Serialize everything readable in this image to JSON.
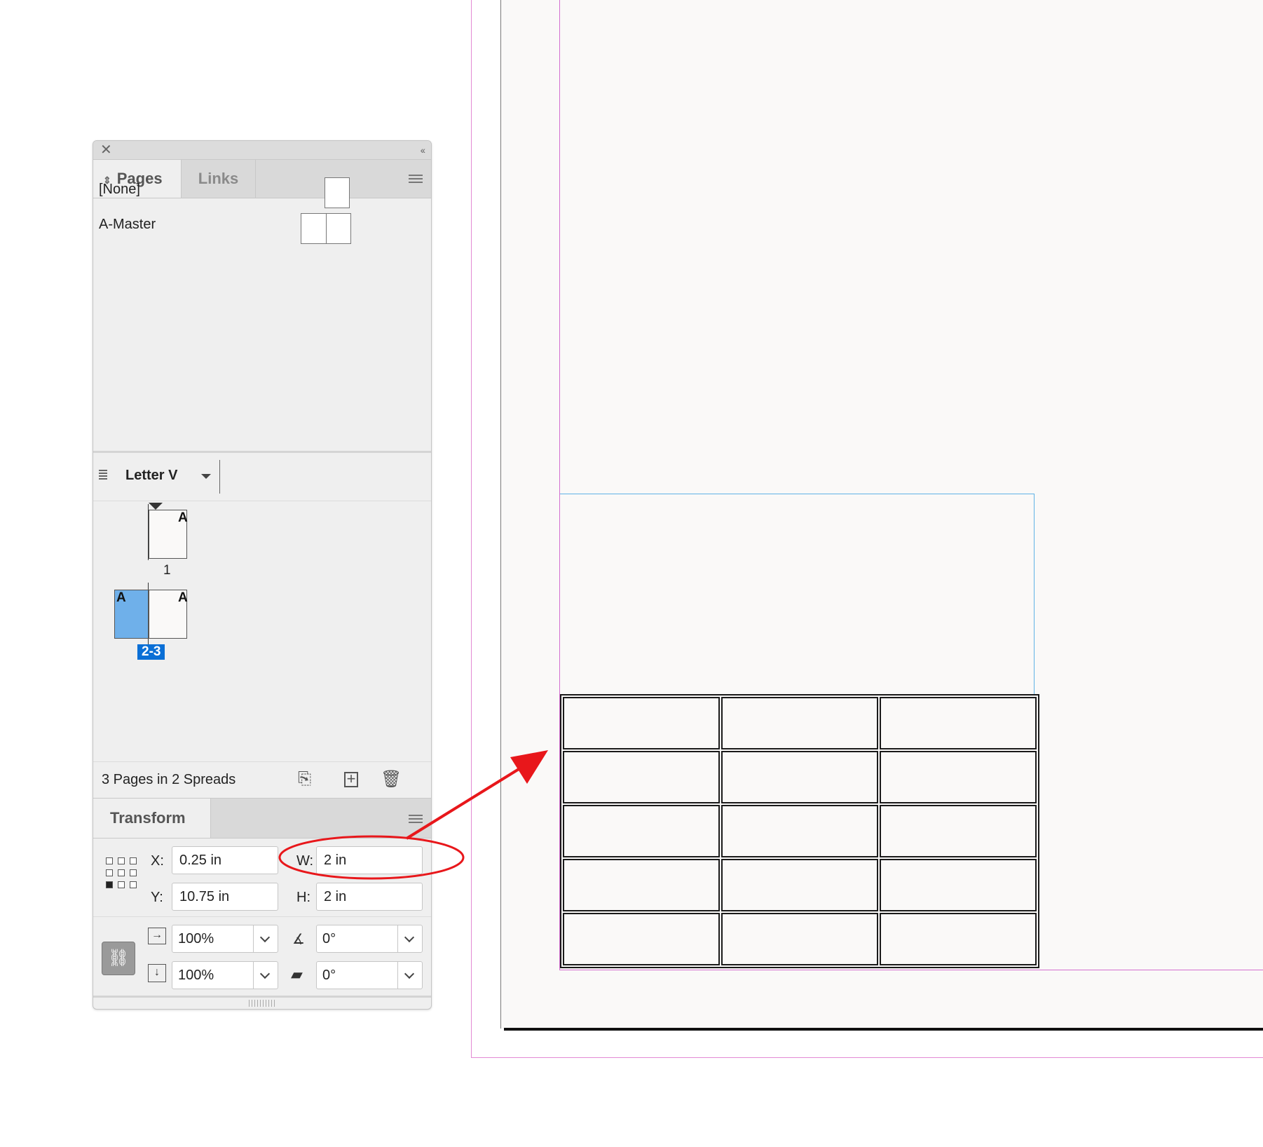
{
  "panel": {
    "title_tabs": [
      "Pages",
      "Links"
    ],
    "masters": [
      "[None]",
      "A-Master"
    ],
    "page_size": "Letter V",
    "pages": [
      {
        "number": "1",
        "master_letter": "A",
        "selected": false
      },
      {
        "number": "2-3",
        "master_letters": [
          "A",
          "A"
        ],
        "selected": true
      }
    ],
    "footer_text": "3 Pages in 2 Spreads"
  },
  "transform": {
    "tab_label": "Transform",
    "x_label": "X:",
    "x_value": "0.25 in",
    "y_label": "Y:",
    "y_value": "10.75 in",
    "w_label": "W:",
    "w_value": "2 in",
    "h_label": "H:",
    "h_value": "2 in",
    "scale_x": "100%",
    "scale_y": "100%",
    "rotate": "0°",
    "shear": "0°"
  },
  "document": {
    "table_rows": 5,
    "table_cols": 3
  },
  "annotation": {
    "color": "#e8171b"
  },
  "icons": {
    "close": "close-icon",
    "collapse": "collapse-icon",
    "panel_menu": "menu-icon",
    "edit_page_size": "edit-page-size-icon",
    "new_page": "new-page-icon",
    "delete": "trash-icon",
    "constrain": "link-icon"
  }
}
